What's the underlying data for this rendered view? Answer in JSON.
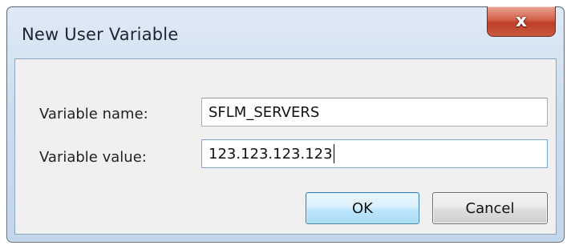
{
  "window": {
    "title": "New User Variable",
    "close_glyph": "x"
  },
  "form": {
    "name_label": "Variable name:",
    "name_value": "SFLM_SERVERS",
    "value_label": "Variable value:",
    "value_value": "123.123.123.123"
  },
  "buttons": {
    "ok_label": "OK",
    "cancel_label": "Cancel"
  },
  "icons": {
    "close": "close-icon"
  },
  "colors": {
    "close_button": "#c94a33",
    "ok_button_border": "#3c7fb1",
    "title_bar": "#cbdcee"
  }
}
